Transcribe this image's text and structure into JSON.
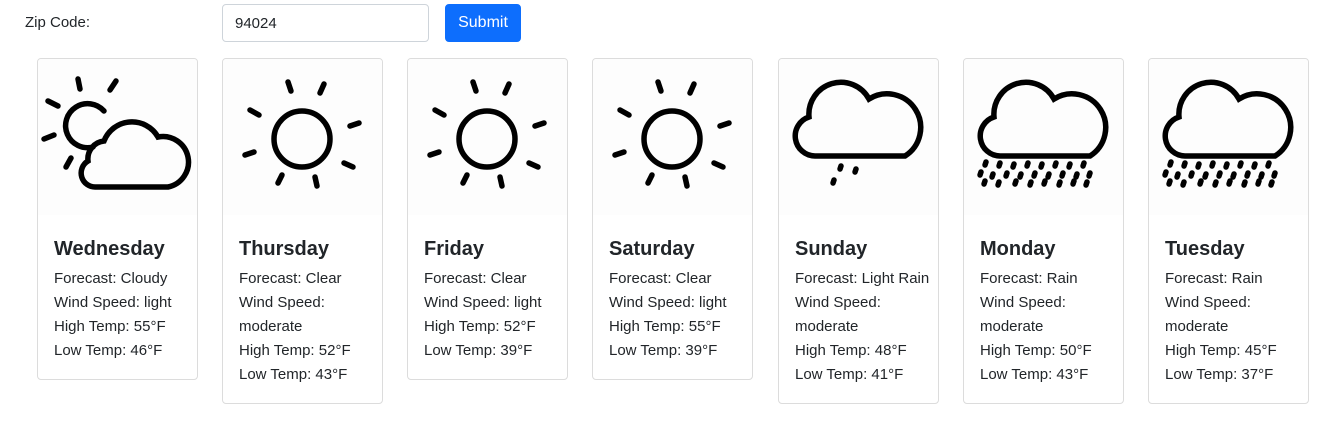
{
  "form": {
    "zip_label": "Zip Code:",
    "zip_value": "94024",
    "submit_label": "Submit",
    "accent_color": "#0d6efd"
  },
  "forecast": [
    {
      "day": "Wednesday",
      "icon": "partly-cloudy-icon",
      "forecast": "Forecast: Cloudy",
      "wind": "Wind Speed: light",
      "high": "High Temp: 55°F",
      "low": "Low Temp: 46°F"
    },
    {
      "day": "Thursday",
      "icon": "sun-icon",
      "forecast": "Forecast: Clear",
      "wind": "Wind Speed: moderate",
      "high": "High Temp: 52°F",
      "low": "Low Temp: 43°F"
    },
    {
      "day": "Friday",
      "icon": "sun-icon",
      "forecast": "Forecast: Clear",
      "wind": "Wind Speed: light",
      "high": "High Temp: 52°F",
      "low": "Low Temp: 39°F"
    },
    {
      "day": "Saturday",
      "icon": "sun-icon",
      "forecast": "Forecast: Clear",
      "wind": "Wind Speed: light",
      "high": "High Temp: 55°F",
      "low": "Low Temp: 39°F"
    },
    {
      "day": "Sunday",
      "icon": "light-rain-icon",
      "forecast": "Forecast: Light Rain",
      "wind": "Wind Speed: moderate",
      "high": "High Temp: 48°F",
      "low": "Low Temp: 41°F"
    },
    {
      "day": "Monday",
      "icon": "rain-icon",
      "forecast": "Forecast: Rain",
      "wind": "Wind Speed: moderate",
      "high": "High Temp: 50°F",
      "low": "Low Temp: 43°F"
    },
    {
      "day": "Tuesday",
      "icon": "rain-icon",
      "forecast": "Forecast: Rain",
      "wind": "Wind Speed: moderate",
      "high": "High Temp: 45°F",
      "low": "Low Temp: 37°F"
    }
  ]
}
